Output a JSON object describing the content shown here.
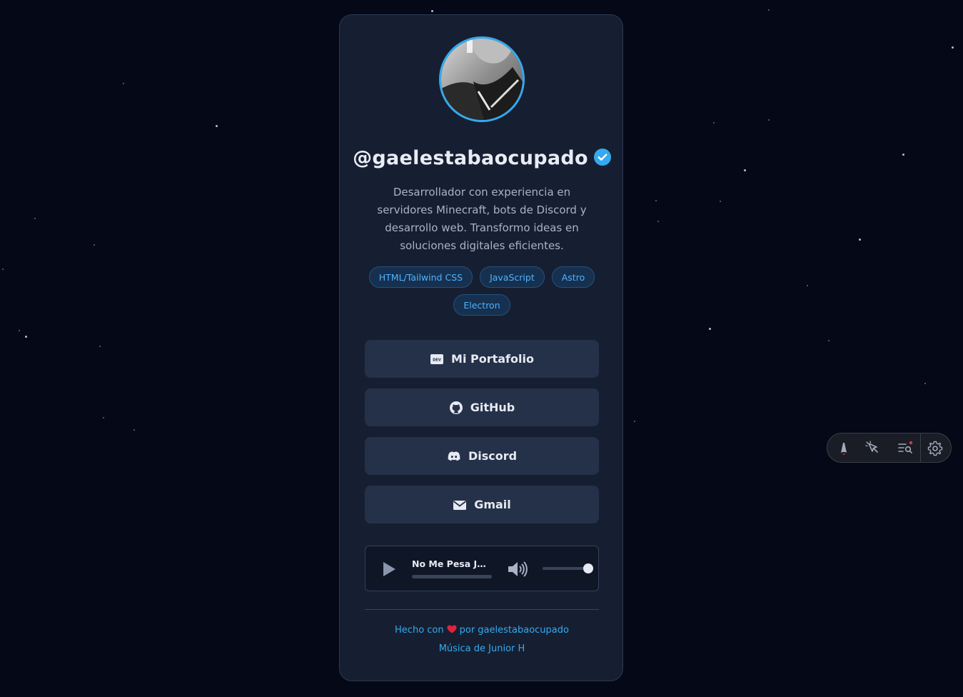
{
  "profile": {
    "username": "@gaelestabaocupado",
    "bio": "Desarrollador con experiencia en servidores Minecraft, bots de Discord y desarrollo web. Transformo ideas en soluciones digitales eficientes.",
    "verified": true
  },
  "tags": [
    {
      "label": "HTML/Tailwind CSS"
    },
    {
      "label": "JavaScript"
    },
    {
      "label": "Astro"
    },
    {
      "label": "Electron"
    }
  ],
  "links": [
    {
      "label": "Mi Portafolio",
      "icon": "dev-icon"
    },
    {
      "label": "GitHub",
      "icon": "github-icon"
    },
    {
      "label": "Discord",
      "icon": "discord-icon"
    },
    {
      "label": "Gmail",
      "icon": "mail-icon"
    }
  ],
  "player": {
    "track_title": "No Me Pesa Junior H",
    "progress": 0.0,
    "volume": 1.0
  },
  "footer": {
    "made_with": "Hecho con",
    "by": "por gaelestabaocupado",
    "music_credit": "Música de Junior H"
  },
  "toolbar": {
    "icons": [
      "astro-logo-icon",
      "cursor-inspect-icon",
      "audit-list-icon",
      "settings-icon"
    ]
  },
  "colors": {
    "background": "#050816",
    "card": "#161f31",
    "accent": "#36a9ee",
    "button": "#253149",
    "tag_text": "#4fb3ff",
    "heart": "#e0243a"
  }
}
